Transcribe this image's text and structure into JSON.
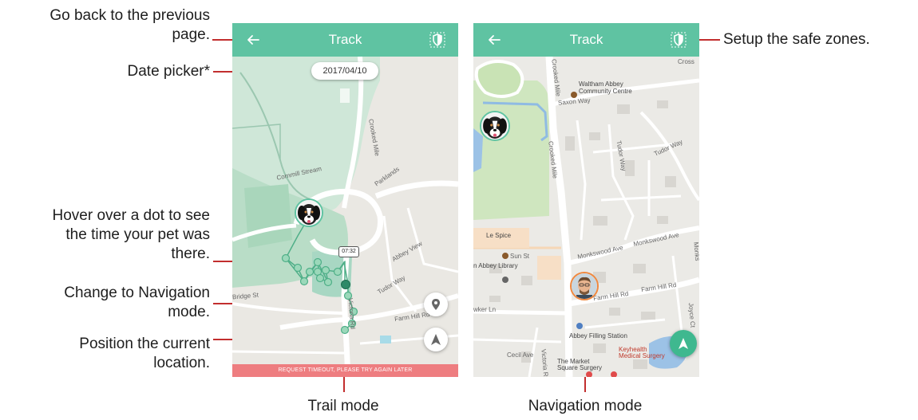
{
  "annotations": {
    "back": "Go back to the previous page.",
    "back_line1": "Go back to the previous",
    "back_line2": "page.",
    "date_picker": "Date picker*",
    "hover_line1": "Hover over a dot to see",
    "hover_line2": "the time your pet was",
    "hover_line3": "there.",
    "nav_line1": "Change to Navigation",
    "nav_line2": "mode.",
    "pos_line1": "Position the current",
    "pos_line2": "location.",
    "safe_zones": "Setup the safe zones.",
    "trail_mode": "Trail mode",
    "navigation_mode": "Navigation mode"
  },
  "trail_screen": {
    "title": "Track",
    "date": "2017/04/10",
    "time_tooltip": "07:32",
    "error_message": "REQUEST TIMEOUT, PLEASE TRY AGAIN LATER",
    "map_labels": [
      "Cornmill Stream",
      "Crooked Mile",
      "Parklands",
      "Farm Hill Rd",
      "Victoria Rd",
      "Abbey View",
      "Tudor Way",
      "Bridge St"
    ]
  },
  "navigation_screen": {
    "title": "Track",
    "map_labels": {
      "community": "Waltham Abbey\nCommunity Centre",
      "community_l1": "Waltham Abbey",
      "community_l2": "Community Centre",
      "saxon": "Saxon Way",
      "crooked": "Crooked Mile",
      "tudor": "Tudor Way",
      "monkswood": "Monkswood Ave",
      "lespice": "Le Spice",
      "sunst": "Sun St",
      "library": "n Abbey Library",
      "farmhill": "Farm Hill Rd",
      "farmhill2": "Farm Hill Rd",
      "filling": "Abbey Filling Station",
      "wakerln": "wker Ln",
      "cecil": "Cecil Ave",
      "victoria": "Victoria Rd",
      "market_l1": "The Market",
      "market_l2": "Square Surgery",
      "keyhealth_l1": "Keyhealth",
      "keyhealth_l2": "Medical Surgery",
      "cross": "Cross",
      "joyce": "Joyce Ct",
      "monks2": "Monks"
    }
  },
  "colors": {
    "accent": "#5fc3a2",
    "annotation_line": "#c22e2e",
    "error": "#ee7d80",
    "trail": "#56b98f"
  }
}
